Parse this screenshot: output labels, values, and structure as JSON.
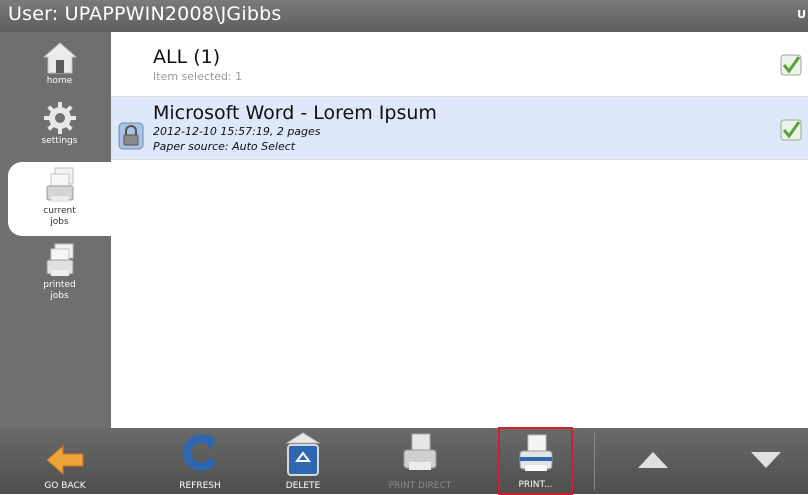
{
  "titlebar": {
    "title": "User: UPAPPWIN2008\\JGibbs",
    "corner": "U"
  },
  "sidebar": {
    "items": [
      {
        "label": "home",
        "icon": "home-icon"
      },
      {
        "label": "settings",
        "icon": "gear-icon"
      },
      {
        "label_line1": "current",
        "label_line2": "jobs",
        "icon": "printer-icon",
        "active": true
      },
      {
        "label_line1": "printed",
        "label_line2": "jobs",
        "icon": "printer-icon"
      }
    ]
  },
  "list": {
    "header": {
      "title": "ALL (1)",
      "subtitle": "Item selected: 1"
    },
    "jobs": [
      {
        "title": "Microsoft Word - Lorem Ipsum",
        "line1": "2012-12-10 15:57:19, 2 pages",
        "line2": "Paper source: Auto Select",
        "selected": true
      }
    ]
  },
  "toolbar": {
    "go_back": "GO BACK",
    "refresh": "REFRESH",
    "delete": "DELETE",
    "print_direct": "PRINT DIRECT",
    "print": "PRINT..."
  },
  "colors": {
    "selected_row": "#dde9f8",
    "highlight": "#d0202a",
    "accent_orange": "#f0a23a",
    "accent_blue": "#2e67b1"
  }
}
